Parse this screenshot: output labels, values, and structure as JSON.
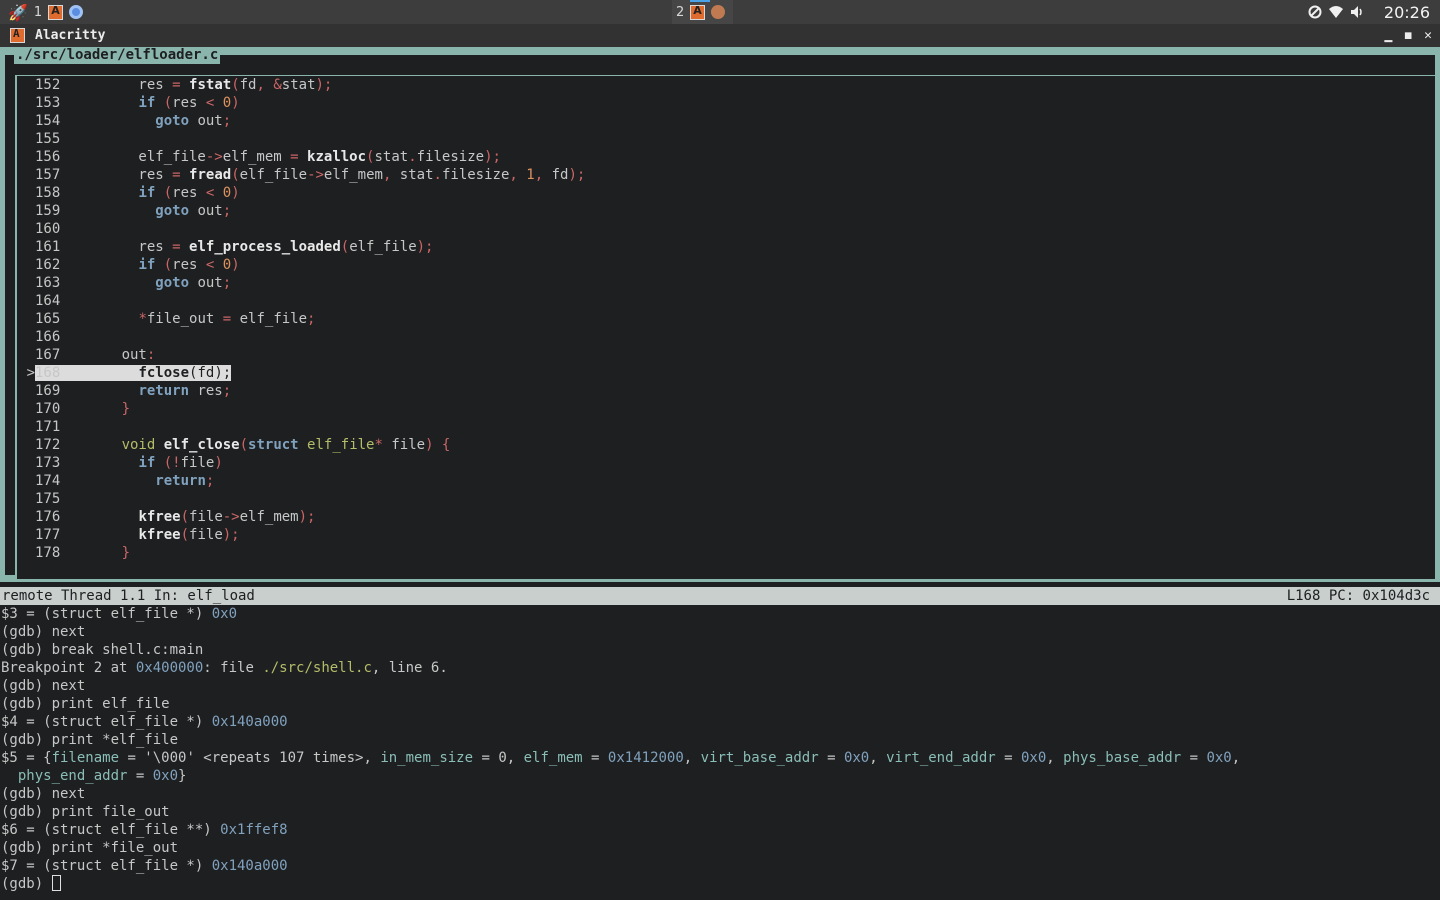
{
  "topbar": {
    "launcher_icon": "rocket-icon",
    "workspace1": {
      "number": "1",
      "apps": [
        "alacritty-icon",
        "chromium-icon"
      ]
    },
    "workspace2": {
      "number": "2",
      "apps": [
        "alacritty-icon",
        "app-icon"
      ]
    },
    "tray_icons": [
      "do-not-disturb-icon",
      "wifi-icon",
      "volume-icon"
    ],
    "clock": "20:26"
  },
  "window": {
    "title": "Alacritty",
    "buttons": [
      "minimize",
      "maximize",
      "close"
    ],
    "button_glyphs": {
      "minimize": "▁",
      "maximize": "◼",
      "close": "✕"
    }
  },
  "source": {
    "filename": "./src/loader/elfloader.c",
    "current_line": "168",
    "current_marker": ">",
    "lines": [
      {
        "n": "152",
        "tokens": [
          [
            "l",
            "        res "
          ],
          [
            "o",
            "="
          ],
          [
            "l",
            " "
          ],
          [
            "f",
            "fstat"
          ],
          [
            "o",
            "("
          ],
          [
            "l",
            "fd"
          ],
          [
            "o",
            ", &"
          ],
          [
            "l",
            "stat"
          ],
          [
            "o",
            ");"
          ]
        ]
      },
      {
        "n": "153",
        "tokens": [
          [
            "l",
            "        "
          ],
          [
            "k",
            "if"
          ],
          [
            "l",
            " "
          ],
          [
            "o",
            "("
          ],
          [
            "l",
            "res "
          ],
          [
            "o",
            "<"
          ],
          [
            "l",
            " "
          ],
          [
            "n",
            "0"
          ],
          [
            "o",
            ")"
          ]
        ]
      },
      {
        "n": "154",
        "tokens": [
          [
            "l",
            "          "
          ],
          [
            "k",
            "goto"
          ],
          [
            "l",
            " out"
          ],
          [
            "o",
            ";"
          ]
        ]
      },
      {
        "n": "155",
        "tokens": [
          [
            "l",
            ""
          ]
        ]
      },
      {
        "n": "156",
        "tokens": [
          [
            "l",
            "        elf_file"
          ],
          [
            "o",
            "->"
          ],
          [
            "l",
            "elf_mem "
          ],
          [
            "o",
            "="
          ],
          [
            "l",
            " "
          ],
          [
            "f",
            "kzalloc"
          ],
          [
            "o",
            "("
          ],
          [
            "l",
            "stat"
          ],
          [
            "o",
            "."
          ],
          [
            "l",
            "filesize"
          ],
          [
            "o",
            ");"
          ]
        ]
      },
      {
        "n": "157",
        "tokens": [
          [
            "l",
            "        res "
          ],
          [
            "o",
            "="
          ],
          [
            "l",
            " "
          ],
          [
            "f",
            "fread"
          ],
          [
            "o",
            "("
          ],
          [
            "l",
            "elf_file"
          ],
          [
            "o",
            "->"
          ],
          [
            "l",
            "elf_mem"
          ],
          [
            "o",
            ","
          ],
          [
            "l",
            " stat"
          ],
          [
            "o",
            "."
          ],
          [
            "l",
            "filesize"
          ],
          [
            "o",
            ","
          ],
          [
            "l",
            " "
          ],
          [
            "n",
            "1"
          ],
          [
            "o",
            ","
          ],
          [
            "l",
            " fd"
          ],
          [
            "o",
            ");"
          ]
        ]
      },
      {
        "n": "158",
        "tokens": [
          [
            "l",
            "        "
          ],
          [
            "k",
            "if"
          ],
          [
            "l",
            " "
          ],
          [
            "o",
            "("
          ],
          [
            "l",
            "res "
          ],
          [
            "o",
            "<"
          ],
          [
            "l",
            " "
          ],
          [
            "n",
            "0"
          ],
          [
            "o",
            ")"
          ]
        ]
      },
      {
        "n": "159",
        "tokens": [
          [
            "l",
            "          "
          ],
          [
            "k",
            "goto"
          ],
          [
            "l",
            " out"
          ],
          [
            "o",
            ";"
          ]
        ]
      },
      {
        "n": "160",
        "tokens": [
          [
            "l",
            ""
          ]
        ]
      },
      {
        "n": "161",
        "tokens": [
          [
            "l",
            "        res "
          ],
          [
            "o",
            "="
          ],
          [
            "l",
            " "
          ],
          [
            "f",
            "elf_process_loaded"
          ],
          [
            "o",
            "("
          ],
          [
            "l",
            "elf_file"
          ],
          [
            "o",
            ");"
          ]
        ]
      },
      {
        "n": "162",
        "tokens": [
          [
            "l",
            "        "
          ],
          [
            "k",
            "if"
          ],
          [
            "l",
            " "
          ],
          [
            "o",
            "("
          ],
          [
            "l",
            "res "
          ],
          [
            "o",
            "<"
          ],
          [
            "l",
            " "
          ],
          [
            "n",
            "0"
          ],
          [
            "o",
            ")"
          ]
        ]
      },
      {
        "n": "163",
        "tokens": [
          [
            "l",
            "          "
          ],
          [
            "k",
            "goto"
          ],
          [
            "l",
            " out"
          ],
          [
            "o",
            ";"
          ]
        ]
      },
      {
        "n": "164",
        "tokens": [
          [
            "l",
            ""
          ]
        ]
      },
      {
        "n": "165",
        "tokens": [
          [
            "l",
            "        "
          ],
          [
            "o",
            "*"
          ],
          [
            "l",
            "file_out "
          ],
          [
            "o",
            "="
          ],
          [
            "l",
            " elf_file"
          ],
          [
            "o",
            ";"
          ]
        ]
      },
      {
        "n": "166",
        "tokens": [
          [
            "l",
            ""
          ]
        ]
      },
      {
        "n": "167",
        "tokens": [
          [
            "l",
            "      out"
          ],
          [
            "o",
            ":"
          ]
        ]
      },
      {
        "n": "168",
        "tokens": [
          [
            "l",
            "        "
          ],
          [
            "f",
            "fclose"
          ],
          [
            "o",
            "("
          ],
          [
            "l",
            "fd"
          ],
          [
            "o",
            ");"
          ]
        ]
      },
      {
        "n": "169",
        "tokens": [
          [
            "l",
            "        "
          ],
          [
            "k",
            "return"
          ],
          [
            "l",
            " res"
          ],
          [
            "o",
            ";"
          ]
        ]
      },
      {
        "n": "170",
        "tokens": [
          [
            "l",
            "      "
          ],
          [
            "o",
            "}"
          ]
        ]
      },
      {
        "n": "171",
        "tokens": [
          [
            "l",
            ""
          ]
        ]
      },
      {
        "n": "172",
        "tokens": [
          [
            "l",
            "      "
          ],
          [
            "ty",
            "void"
          ],
          [
            "l",
            " "
          ],
          [
            "f",
            "elf_close"
          ],
          [
            "o",
            "("
          ],
          [
            "k",
            "struct"
          ],
          [
            "l",
            " "
          ],
          [
            "ty",
            "elf_file"
          ],
          [
            "o",
            "*"
          ],
          [
            "l",
            " file"
          ],
          [
            "o",
            ") {"
          ]
        ]
      },
      {
        "n": "173",
        "tokens": [
          [
            "l",
            "        "
          ],
          [
            "k",
            "if"
          ],
          [
            "l",
            " "
          ],
          [
            "o",
            "(!"
          ],
          [
            "l",
            "file"
          ],
          [
            "o",
            ")"
          ]
        ]
      },
      {
        "n": "174",
        "tokens": [
          [
            "l",
            "          "
          ],
          [
            "k",
            "return"
          ],
          [
            "o",
            ";"
          ]
        ]
      },
      {
        "n": "175",
        "tokens": [
          [
            "l",
            ""
          ]
        ]
      },
      {
        "n": "176",
        "tokens": [
          [
            "l",
            "        "
          ],
          [
            "f",
            "kfree"
          ],
          [
            "o",
            "("
          ],
          [
            "l",
            "file"
          ],
          [
            "o",
            "->"
          ],
          [
            "l",
            "elf_mem"
          ],
          [
            "o",
            ");"
          ]
        ]
      },
      {
        "n": "177",
        "tokens": [
          [
            "l",
            "        "
          ],
          [
            "f",
            "kfree"
          ],
          [
            "o",
            "("
          ],
          [
            "l",
            "file"
          ],
          [
            "o",
            ");"
          ]
        ]
      },
      {
        "n": "178",
        "tokens": [
          [
            "l",
            "      "
          ],
          [
            "o",
            "}"
          ]
        ]
      }
    ]
  },
  "status": {
    "left": "remote Thread 1.1 In: elf_load",
    "right": "L168   PC: 0x104d3c"
  },
  "console": {
    "lines": [
      [
        [
          "p",
          "$3 = (struct elf_file *) "
        ],
        [
          "a",
          "0x0"
        ]
      ],
      [
        [
          "p",
          "(gdb) next"
        ]
      ],
      [
        [
          "p",
          "(gdb) break shell.c:main"
        ]
      ],
      [
        [
          "p",
          "Breakpoint 2 at "
        ],
        [
          "a",
          "0x400000"
        ],
        [
          "p",
          ": file "
        ],
        [
          "fi",
          "./src/shell.c"
        ],
        [
          "p",
          ", line 6."
        ]
      ],
      [
        [
          "p",
          "(gdb) next"
        ]
      ],
      [
        [
          "p",
          "(gdb) print elf_file"
        ]
      ],
      [
        [
          "p",
          "$4 = (struct elf_file *) "
        ],
        [
          "a",
          "0x140a000"
        ]
      ],
      [
        [
          "p",
          "(gdb) print *elf_file"
        ]
      ],
      [
        [
          "p",
          "$5 = {"
        ],
        [
          "fd",
          "filename"
        ],
        [
          "p",
          " = '\\000' <repeats 107 times>, "
        ],
        [
          "fd",
          "in_mem_size"
        ],
        [
          "p",
          " = 0, "
        ],
        [
          "fd",
          "elf_mem"
        ],
        [
          "p",
          " = "
        ],
        [
          "a",
          "0x1412000"
        ],
        [
          "p",
          ", "
        ],
        [
          "fd",
          "virt_base_addr"
        ],
        [
          "p",
          " = "
        ],
        [
          "a",
          "0x0"
        ],
        [
          "p",
          ", "
        ],
        [
          "fd",
          "virt_end_addr"
        ],
        [
          "p",
          " = "
        ],
        [
          "a",
          "0x0"
        ],
        [
          "p",
          ", "
        ],
        [
          "fd",
          "phys_base_addr"
        ],
        [
          "p",
          " = "
        ],
        [
          "a",
          "0x0"
        ],
        [
          "p",
          ","
        ]
      ],
      [
        [
          "p",
          "  "
        ],
        [
          "fd",
          "phys_end_addr"
        ],
        [
          "p",
          " = "
        ],
        [
          "a",
          "0x0"
        ],
        [
          "p",
          "}"
        ]
      ],
      [
        [
          "p",
          "(gdb) next"
        ]
      ],
      [
        [
          "p",
          "(gdb) print file_out"
        ]
      ],
      [
        [
          "p",
          "$6 = (struct elf_file **) "
        ],
        [
          "a",
          "0x1ffef8"
        ]
      ],
      [
        [
          "p",
          "(gdb) print *file_out"
        ]
      ],
      [
        [
          "p",
          "$7 = (struct elf_file *) "
        ],
        [
          "a",
          "0x140a000"
        ]
      ]
    ],
    "prompt": "(gdb) "
  },
  "colors": {
    "background": "#1d1f21",
    "frame": "#8ab5ad",
    "keyword": "#81a2be",
    "operator": "#cc6666",
    "number": "#de935f",
    "type": "#b5bd68",
    "field": "#8abeb7",
    "highlight": "#dcdcdc"
  }
}
